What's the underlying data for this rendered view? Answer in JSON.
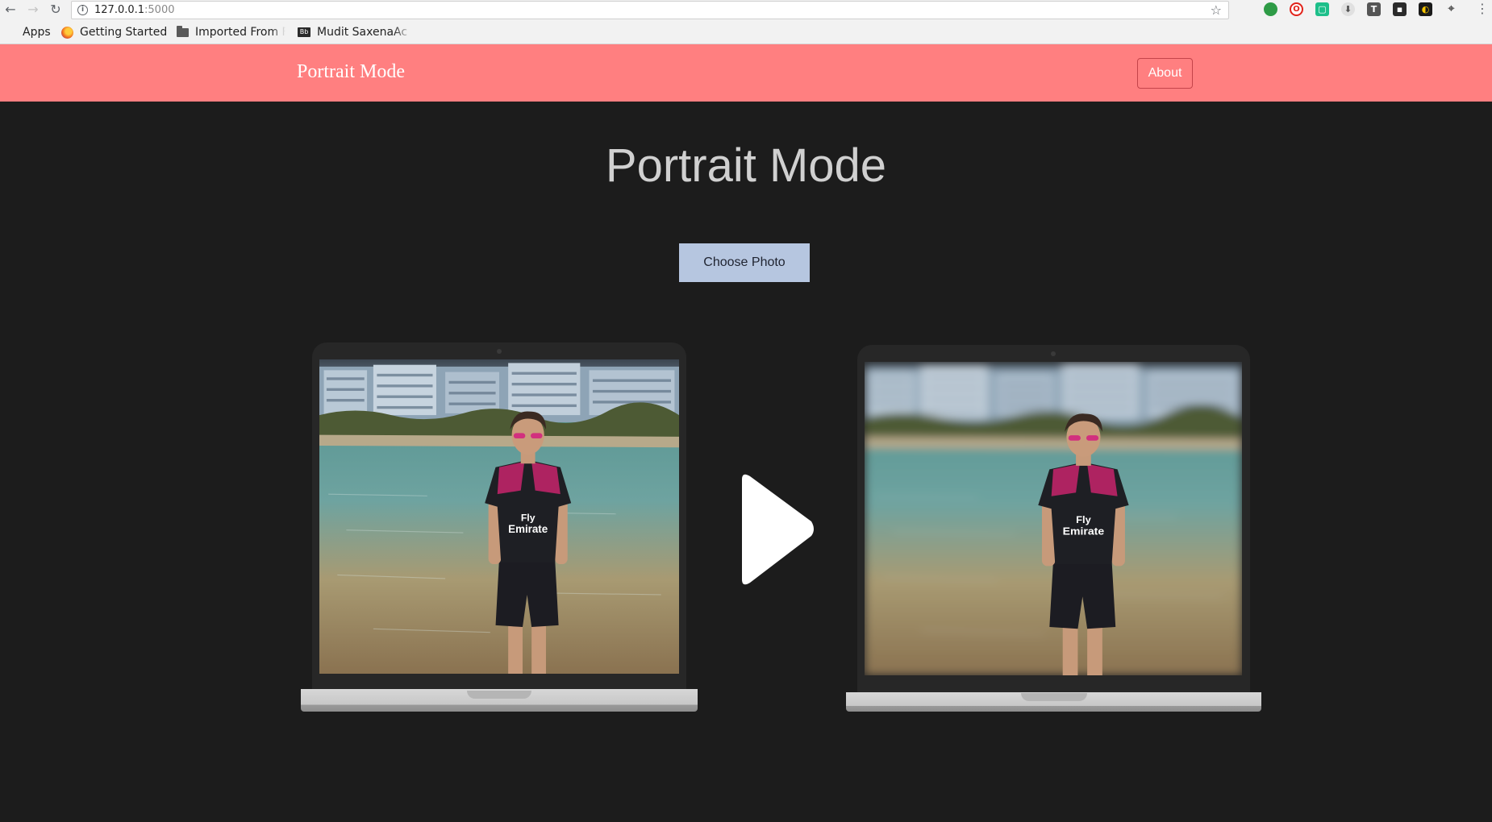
{
  "browser": {
    "url_host": "127.0.0.1",
    "url_port": ":5000",
    "bookmarks": {
      "apps": "Apps",
      "getting_started": "Getting Started",
      "imported": "Imported From F",
      "mudit": "Mudit SaxenaAc"
    },
    "extensions": [
      {
        "name": "evernote-icon",
        "color": "#2e9b46",
        "glyph": "⬤"
      },
      {
        "name": "opera-icon",
        "color": "#e2231a",
        "glyph": "O"
      },
      {
        "name": "pushbullet-icon",
        "color": "#1dbf8a",
        "glyph": "▢"
      },
      {
        "name": "download-icon",
        "color": "#555555",
        "glyph": "⬇"
      },
      {
        "name": "text-icon",
        "color": "#555555",
        "glyph": "T"
      },
      {
        "name": "imdb-icon",
        "color": "#2b2b2b",
        "glyph": "▪"
      },
      {
        "name": "pacman-icon",
        "color": "#1a1a1a",
        "glyph": "◐"
      },
      {
        "name": "location-icon",
        "color": "#555555",
        "glyph": "⌖"
      }
    ]
  },
  "navbar": {
    "brand": "Portrait Mode",
    "about_label": "About",
    "bg_color": "#ff7f80"
  },
  "main": {
    "title": "Portrait Mode",
    "choose_label": "Choose Photo",
    "button_color": "#b6c6e0",
    "original_image": "original-portrait-photo",
    "result_image": "blurred-background-portrait-photo"
  }
}
